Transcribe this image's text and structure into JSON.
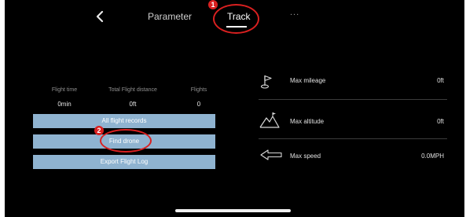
{
  "header": {
    "back_icon": "chevron-left-icon",
    "tabs": [
      {
        "label": "Parameter"
      },
      {
        "label": "Track",
        "active": true
      },
      {
        "label": "..."
      }
    ]
  },
  "annotations": {
    "one": "1",
    "two": "2",
    "color": "#d92020"
  },
  "stats": {
    "headers": [
      "Flight time",
      "Total Flight distance",
      "Flights"
    ],
    "values": [
      "0min",
      "0ft",
      "0"
    ]
  },
  "buttons": {
    "all_records": "All flight records",
    "find_drone": "Find drone",
    "export_log": "Export Flight Log",
    "color": "#8fb3d0"
  },
  "records": [
    {
      "icon": "flag-icon",
      "label": "Max mileage",
      "value": "0ft"
    },
    {
      "icon": "mountain-icon",
      "label": "Max altitude",
      "value": "0ft"
    },
    {
      "icon": "arrow-left-icon",
      "label": "Max speed",
      "value": "0.0MPH"
    }
  ]
}
